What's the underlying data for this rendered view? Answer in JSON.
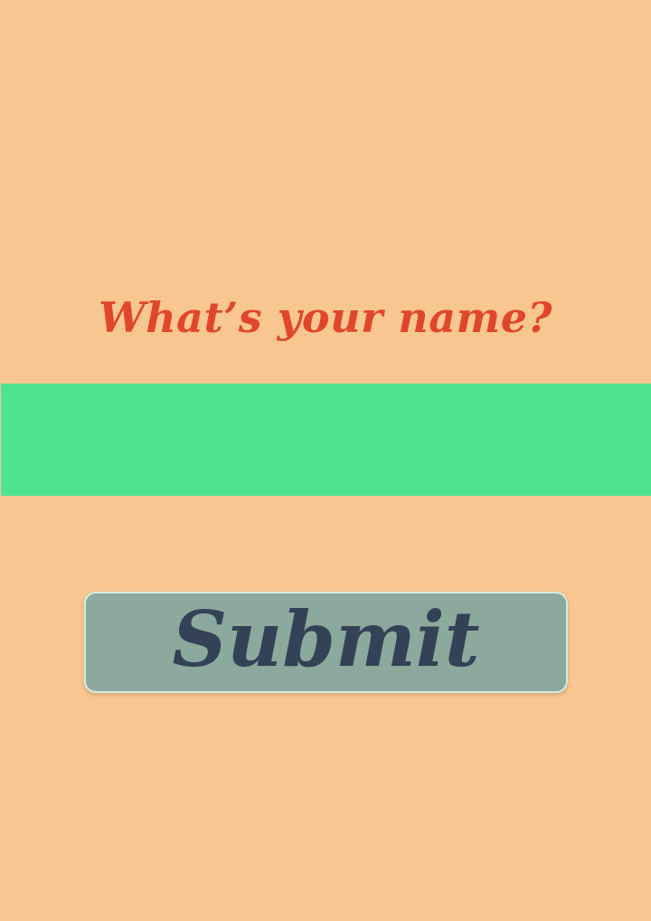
{
  "prompt": {
    "question": "What’s your name?"
  },
  "name_field": {
    "value": "",
    "placeholder": ""
  },
  "submit": {
    "label": "Submit"
  },
  "colors": {
    "background": "#f8c690",
    "question_text": "#e0472a",
    "input_background": "#4ee48e",
    "button_background": "#8ba99c",
    "button_text": "#344257"
  }
}
